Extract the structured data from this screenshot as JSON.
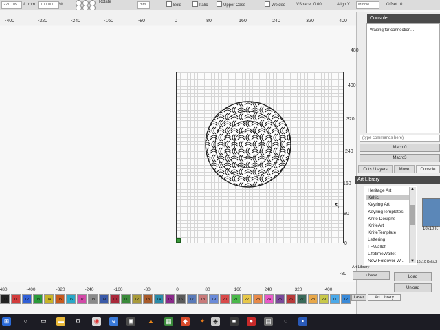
{
  "toolbar": {
    "width_value": "221.105",
    "unit_left": "mm",
    "scale_value": "100.000",
    "unit_pct": "%",
    "rotate_label": "Rotate",
    "unit_right": "mm",
    "bold_label": "Bold",
    "italic_label": "Italic",
    "uppercase_label": "Upper Case",
    "welded_label": "Welded",
    "vspace_label": "VSpace",
    "vspace_value": "0.00",
    "align_label": "Align Y",
    "align_value": "Middle",
    "offset_label": "Offset",
    "offset_value": "0"
  },
  "ruler_top": [
    "-400",
    "-320",
    "-240",
    "-160",
    "-80",
    "0",
    "80",
    "160",
    "240",
    "320",
    "400"
  ],
  "ruler_right": [
    "480",
    "400",
    "320",
    "240",
    "160",
    "80",
    "0",
    "-80"
  ],
  "ruler_bottom": [
    "-480",
    "-400",
    "-320",
    "-240",
    "-160",
    "-80",
    "0",
    "80",
    "160",
    "240",
    "320",
    "400"
  ],
  "palette": [
    {
      "label": "00",
      "color": "#222222"
    },
    {
      "label": "T1",
      "color": "#d23c3c"
    },
    {
      "label": "T2",
      "color": "#2f5fd6"
    },
    {
      "label": "03",
      "color": "#2a9a3a"
    },
    {
      "label": "04",
      "color": "#c8b428"
    },
    {
      "label": "05",
      "color": "#c85a1e"
    },
    {
      "label": "06",
      "color": "#2aa8c8"
    },
    {
      "label": "07",
      "color": "#d24aa8"
    },
    {
      "label": "08",
      "color": "#8a8a8a"
    },
    {
      "label": "09",
      "color": "#3a5aa8"
    },
    {
      "label": "10",
      "color": "#a8283a"
    },
    {
      "label": "11",
      "color": "#3a8a3a"
    },
    {
      "label": "12",
      "color": "#a89a3a"
    },
    {
      "label": "13",
      "color": "#a85a2a"
    },
    {
      "label": "14",
      "color": "#2a8aa8"
    },
    {
      "label": "15",
      "color": "#8a2a8a"
    },
    {
      "label": "16",
      "color": "#5a5a5a"
    },
    {
      "label": "17",
      "color": "#5a7ab8"
    },
    {
      "label": "18",
      "color": "#c87a7a"
    },
    {
      "label": "19",
      "color": "#6a8ad8"
    },
    {
      "label": "20",
      "color": "#d84a4a"
    },
    {
      "label": "21",
      "color": "#4ab84a"
    },
    {
      "label": "22",
      "color": "#e8c84a"
    },
    {
      "label": "23",
      "color": "#e88a4a"
    },
    {
      "label": "24",
      "color": "#e85ac8"
    },
    {
      "label": "25",
      "color": "#7a4a9a"
    },
    {
      "label": "26",
      "color": "#b83a3a"
    },
    {
      "label": "27",
      "color": "#3a6a5a"
    },
    {
      "label": "28",
      "color": "#e8a84a"
    },
    {
      "label": "29",
      "color": "#c8c84a"
    },
    {
      "label": "T1",
      "color": "#4aa8e8"
    },
    {
      "label": "T2",
      "color": "#3a8ad8"
    }
  ],
  "console": {
    "title": "Console",
    "status_text": "Waiting for connection...",
    "command_placeholder": "(type commands here)",
    "macro0": "Macro0",
    "macro3": "Macro3"
  },
  "tabs": {
    "cuts_layers": "Cuts / Layers",
    "move": "Move",
    "console": "Console"
  },
  "art_library": {
    "title": "Art Library",
    "items": [
      "Heritage Art",
      "Keltic",
      "Keyring Art",
      "KeyringTemplates",
      "Knife Designs",
      "KnifeArt",
      "KnifeTemplate",
      "Lettering",
      "LEWallet",
      "LifetimeWallet",
      "New Foldover W..."
    ],
    "selected_index": 1,
    "thumb_caption": "10x10 K",
    "thumb_caption_2": "10x10 Keltic2",
    "footer_label": "Art Library",
    "new_button": "New",
    "load_button": "Load",
    "unload_button": "Unload",
    "bottom_tab_laser": "Laser",
    "bottom_tab_art": "Art Library"
  }
}
